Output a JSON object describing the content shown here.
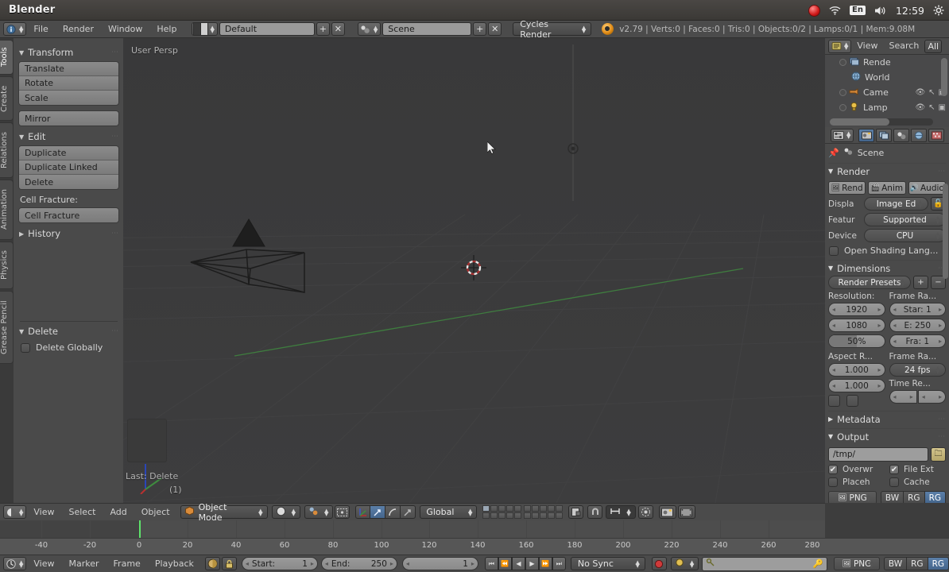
{
  "os": {
    "title": "Blender",
    "tray": {
      "record": "record-indicator",
      "wifi": "wifi-icon",
      "lang": "En",
      "volume": "volume-icon",
      "time": "12:59",
      "settings": "gear-icon"
    }
  },
  "info_header": {
    "editor_type_icon": "info-editor-icon",
    "menus": [
      "File",
      "Render",
      "Window",
      "Help"
    ],
    "screen_layout": "Default",
    "screen_add": "+",
    "screen_remove": "✕",
    "scene_name": "Scene",
    "scene_add": "+",
    "scene_remove": "✕",
    "render_engine": "Cycles Render",
    "status": "v2.79 | Verts:0 | Faces:0 | Tris:0 | Objects:0/2 | Lamps:0/1 | Mem:9.08M"
  },
  "toolshelf": {
    "tabs": [
      {
        "label": "Tools",
        "active": true
      },
      {
        "label": "Create",
        "active": false
      },
      {
        "label": "Relations",
        "active": false
      },
      {
        "label": "Animation",
        "active": false
      },
      {
        "label": "Physics",
        "active": false
      },
      {
        "label": "Grease Pencil",
        "active": false
      }
    ],
    "panels": [
      {
        "title": "Transform",
        "open": true
      },
      {
        "title": "Edit",
        "open": true
      },
      {
        "title": "History",
        "open": false
      }
    ],
    "transform_buttons": [
      "Translate",
      "Rotate",
      "Scale"
    ],
    "mirror_button": "Mirror",
    "edit_buttons": [
      "Duplicate",
      "Duplicate Linked",
      "Delete"
    ],
    "cell_fracture_label": "Cell Fracture:",
    "cell_fracture_button": "Cell Fracture",
    "history_title": "History",
    "delete_panel": {
      "title": "Delete",
      "checkbox_label": "Delete Globally",
      "checked": false
    }
  },
  "viewport": {
    "view_name": "User Persp",
    "operator_panel": {
      "title": "Last: Delete",
      "count": "(1)"
    },
    "objects": [
      "camera-wireframe",
      "lamp-point"
    ],
    "cursor_3d": "3d-cursor"
  },
  "view3d_header": {
    "editor_icon": "view3d-editor-icon",
    "menus": [
      "View",
      "Select",
      "Add",
      "Object"
    ],
    "mode": "Object Mode",
    "viewport_shading": "solid-shading-icon",
    "pivot": "median-point-icon",
    "manipulator_toggle": "manipulator-icon",
    "manipulators": [
      "translate-manipulator",
      "rotate-manipulator",
      "scale-manipulator"
    ],
    "transform_orientation": "Global",
    "layers_row1": [
      true,
      false,
      false,
      false,
      false,
      false,
      false,
      false,
      false,
      false
    ],
    "layers_row2": [
      false,
      false,
      false,
      false,
      false,
      false,
      false,
      false,
      false,
      false
    ],
    "snap_label": "snap-magnet-icon",
    "proportional": "proportional-edit-icon",
    "render_buttons": [
      "render-opengl-icon",
      "render-opengl-anim-icon"
    ]
  },
  "outliner": {
    "header": {
      "editor_icon": "outliner-editor-icon",
      "menus": [
        "View",
        "Search"
      ],
      "display_mode": "All"
    },
    "rows": [
      {
        "label": "Rende",
        "icon": "renderlayers-icon",
        "has_expander": true,
        "icons": []
      },
      {
        "label": "World",
        "icon": "world-icon",
        "has_expander": false,
        "icons": []
      },
      {
        "label": "Came",
        "icon": "camera-icon",
        "has_expander": true,
        "icons": [
          "eye-icon",
          "cursor-icon",
          "camera-restrict-icon"
        ]
      },
      {
        "label": "Lamp",
        "icon": "lamp-icon",
        "has_expander": true,
        "icons": [
          "eye-icon",
          "cursor-icon",
          "camera-restrict-icon"
        ]
      }
    ]
  },
  "properties": {
    "tabs": [
      {
        "name": "render-tab",
        "glyph": "▣",
        "active": true
      },
      {
        "name": "renderlayers-tab",
        "glyph": "❐",
        "active": false
      },
      {
        "name": "scene-tab",
        "glyph": "⚫",
        "active": false
      },
      {
        "name": "world-tab",
        "glyph": "●",
        "active": false
      },
      {
        "name": "texture-tab",
        "glyph": "▒",
        "active": false
      }
    ],
    "breadcrumb": {
      "pin": "pin-icon",
      "icon": "scene-icon",
      "label": "Scene"
    },
    "render_panel": {
      "title": "Render",
      "buttons": [
        {
          "label": "Rend",
          "icon": "render-image-icon"
        },
        {
          "label": "Anim",
          "icon": "render-anim-icon"
        },
        {
          "label": "Audio",
          "icon": "render-audio-icon"
        }
      ],
      "display_label": "Displa",
      "display_value": "Image Ed",
      "display_lock": "unlock-icon",
      "feature_label": "Featur",
      "feature_value": "Supported",
      "device_label": "Device",
      "device_value": "CPU",
      "osl_label": "Open Shading Lang...",
      "osl_checked": false
    },
    "dimensions_panel": {
      "title": "Dimensions",
      "presets": "Render Presets",
      "preset_add": "+",
      "preset_remove": "−",
      "resolution_label": "Resolution:",
      "res_x": "1920",
      "res_y": "1080",
      "res_percent": "50%",
      "frame_range_label": "Frame Ra...",
      "frame_start": "Star: 1",
      "frame_end": "E: 250",
      "frame_step": "Fra:  1",
      "aspect_label": "Aspect R...",
      "aspect_x": "1.000",
      "aspect_y": "1.000",
      "fps_label": "Frame Ra...",
      "fps_value": "24 fps",
      "time_remap_label": "Time Re..."
    },
    "metadata_panel": {
      "title": "Metadata",
      "open": false
    },
    "output_panel": {
      "title": "Output",
      "path": "/tmp/",
      "browse": "folder-icon",
      "overwrite_label": "Overwr",
      "overwrite_checked": true,
      "fileext_label": "File Ext",
      "fileext_checked": true,
      "placeholder_label": "Placeh",
      "placeholder_checked": false,
      "cache_label": "Cache",
      "cache_checked": false,
      "file_format": "PNG",
      "color_modes": [
        {
          "label": "BW",
          "active": false
        },
        {
          "label": "RG",
          "active": false
        },
        {
          "label": "RG",
          "active": true
        }
      ]
    }
  },
  "timeline": {
    "ticks": [
      "-40",
      "-20",
      "0",
      "20",
      "40",
      "60",
      "80",
      "100",
      "120",
      "140",
      "160",
      "180",
      "200",
      "220",
      "240",
      "260",
      "280"
    ],
    "current_frame": 1,
    "header": {
      "editor_icon": "timeline-editor-icon",
      "menus": [
        "View",
        "Marker",
        "Frame",
        "Playback"
      ],
      "auto_key": "record-icon",
      "lock": "lock-icon",
      "start_label": "Start:",
      "start_value": "1",
      "end_label": "End:",
      "end_value": "250",
      "frame_value": "1",
      "transport": [
        "jump-start-icon",
        "prev-keyframe-icon",
        "play-reverse-icon",
        "play-icon",
        "next-keyframe-icon",
        "jump-end-icon"
      ],
      "sync_mode": "No Sync",
      "record_button": "auto-keyframe-icon",
      "keying_set_icon": "keyingset-icon",
      "keying_set_value": ""
    }
  },
  "colors": {
    "accent_blue": "#4a6c96",
    "playhead_green": "#5ee26a",
    "axis_green": "#3a7d3a",
    "window_bg": "#3d3d3d",
    "panel_bg": "#4a4a4a",
    "viewport_bg": "#39393a"
  }
}
